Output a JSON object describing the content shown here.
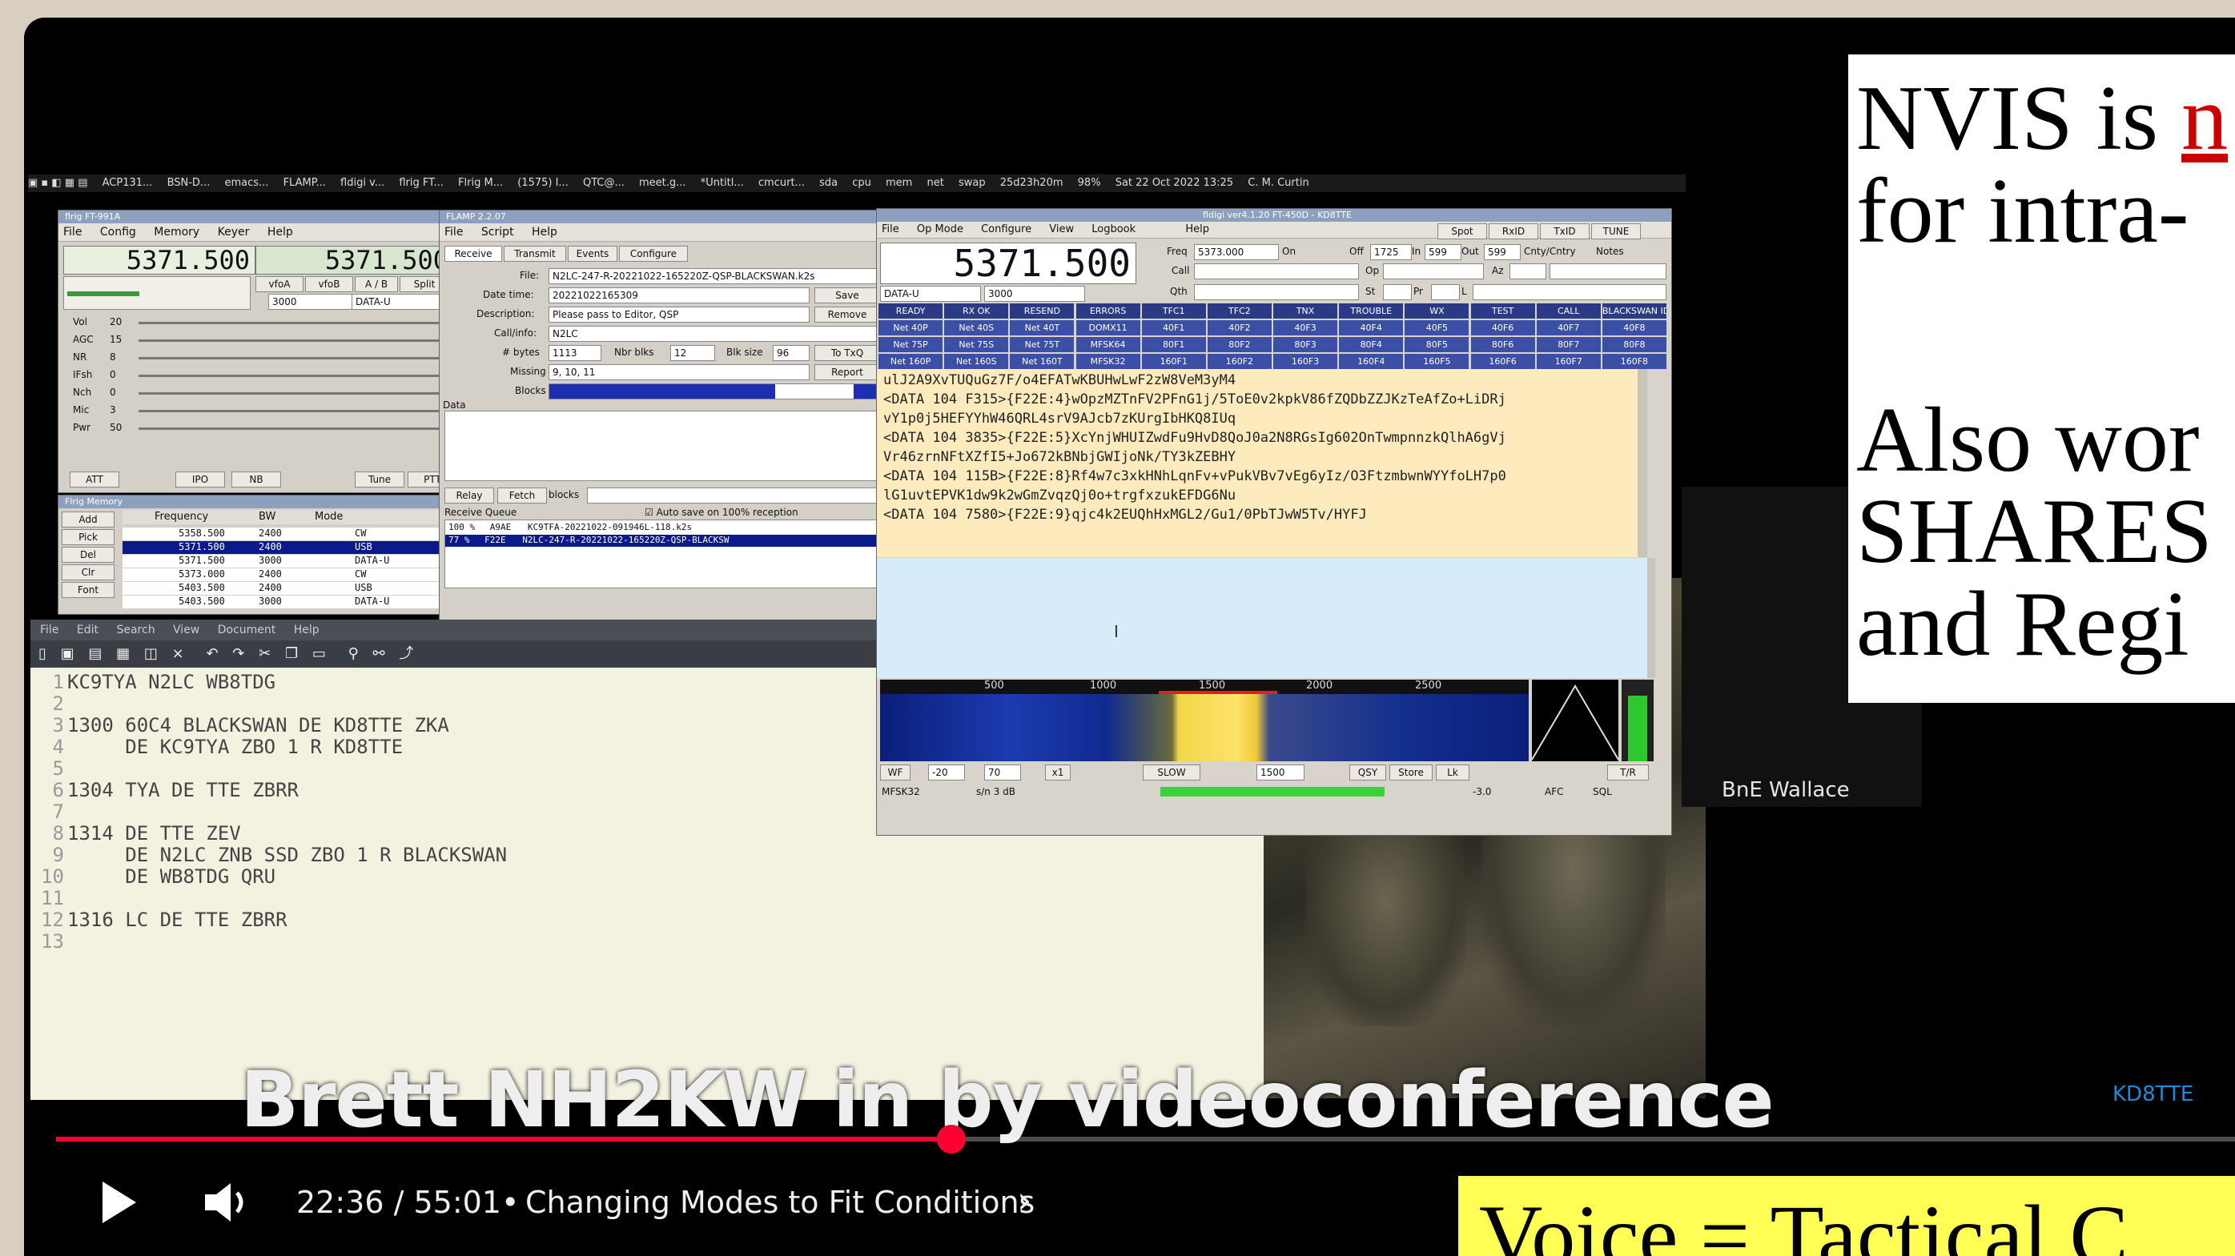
{
  "taskbar": {
    "items": [
      "ACP131...",
      "BSN-D...",
      "emacs...",
      "FLAMP...",
      "fldigi v...",
      "flrig FT...",
      "Flrig M...",
      "(1575) I...",
      "QTC@...",
      "meet.g...",
      "*Untitl...",
      "cmcurt...",
      "sda",
      "cpu",
      "mem",
      "net",
      "swap",
      "25d23h20m",
      "98%",
      "Sat 22 Oct 2022 13:25",
      "C. M. Curtin"
    ]
  },
  "flrig": {
    "title": "flrig FT-991A",
    "menu": [
      "File",
      "Config",
      "Memory",
      "Keyer",
      "Help"
    ],
    "freq_a": "5371.500",
    "freq_b": "5371.500",
    "buttons": [
      "vfoA",
      "vfoB",
      "A / B",
      "Split"
    ],
    "bw": "3000",
    "mode": "DATA-U",
    "sliders": [
      {
        "label": "Vol",
        "value": "20"
      },
      {
        "label": "AGC",
        "value": "15"
      },
      {
        "label": "NR",
        "value": "8"
      },
      {
        "label": "IFsh",
        "value": "0"
      },
      {
        "label": "Nch",
        "value": "0"
      },
      {
        "label": "Mic",
        "value": "3"
      },
      {
        "label": "Pwr",
        "value": "50"
      }
    ],
    "bottom_buttons": [
      "ATT",
      "IPO",
      "NB",
      "Tune",
      "PTT"
    ]
  },
  "memory": {
    "title": "Flrig Memory",
    "headers": [
      "Frequency",
      "BW",
      "Mode"
    ],
    "side_buttons": [
      "Add",
      "Pick",
      "Del",
      "Clr",
      "Font"
    ],
    "rows": [
      {
        "freq": "5358.500",
        "bw": "2400",
        "mode": "CW",
        "x": "60"
      },
      {
        "freq": "5371.500",
        "bw": "2400",
        "mode": "USB",
        "x": "60"
      },
      {
        "freq": "5371.500",
        "bw": "3000",
        "mode": "DATA-U",
        "x": "60"
      },
      {
        "freq": "5373.000",
        "bw": "2400",
        "mode": "CW",
        "x": "60"
      },
      {
        "freq": "5403.500",
        "bw": "2400",
        "mode": "USB",
        "x": "60"
      },
      {
        "freq": "5403.500",
        "bw": "3000",
        "mode": "DATA-U",
        "x": "60"
      }
    ]
  },
  "flamp": {
    "title": "FLAMP 2.2.07",
    "menu": [
      "File",
      "Script",
      "Help"
    ],
    "tabs": [
      "Receive",
      "Transmit",
      "Events",
      "Configure"
    ],
    "file_label": "File:",
    "file": "N2LC-247-R-20221022-165220Z-QSP-BLACKSWAN.k2s",
    "datetime_label": "Date time:",
    "datetime": "20221022165309",
    "save": "Save",
    "desc_label": "Description:",
    "desc": "Please pass to Editor, QSP",
    "remove": "Remove",
    "callinfo_label": "Call/info:",
    "callinfo": "N2LC",
    "bytes_label": "# bytes",
    "bytes": "1113",
    "nblks_label": "Nbr blks",
    "nblks": "12",
    "blksize_label": "Blk size",
    "blksize": "96",
    "totxq": "To TxQ",
    "missing_label": "Missing",
    "missing": "9, 10, 11",
    "report": "Report",
    "blocks_label": "Blocks",
    "data_label": "Data",
    "relay": "Relay",
    "fetch": "Fetch",
    "blocks2": "blocks",
    "queue_label": "Receive Queue",
    "autosave": "Auto save on 100% reception",
    "queue": [
      {
        "pct": "100 %",
        "id": "A9AE",
        "file": "KC9TFA-20221022-091946L-118.k2s"
      },
      {
        "pct": "77 %",
        "id": "F22E",
        "file": "N2LC-247-R-20221022-165220Z-QSP-BLACKSW"
      }
    ]
  },
  "editor": {
    "menu": [
      "File",
      "Edit",
      "Search",
      "View",
      "Document",
      "Help"
    ],
    "lines": [
      {
        "n": "1",
        "text": "KC9TYA N2LC WB8TDG"
      },
      {
        "n": "2",
        "text": ""
      },
      {
        "n": "3",
        "text": "1300 60C4 BLACKSWAN DE KD8TTE ZKA"
      },
      {
        "n": "4",
        "text": "     DE KC9TYA ZBO 1 R KD8TTE"
      },
      {
        "n": "5",
        "text": ""
      },
      {
        "n": "6",
        "text": "1304 TYA DE TTE ZBRR"
      },
      {
        "n": "7",
        "text": ""
      },
      {
        "n": "8",
        "text": "1314 DE TTE ZEV"
      },
      {
        "n": "9",
        "text": "     DE N2LC ZNB SSD ZBO 1 R BLACKSWAN"
      },
      {
        "n": "10",
        "text": "     DE WB8TDG QRU"
      },
      {
        "n": "11",
        "text": ""
      },
      {
        "n": "12",
        "text": "1316 LC DE TTE ZBRR"
      },
      {
        "n": "13",
        "text": ""
      }
    ]
  },
  "fldigi": {
    "title": "fldigi ver4.1.20 FT-450D - KD8TTE",
    "menu": [
      "File",
      "Op Mode",
      "Configure",
      "View",
      "Logbook",
      "Help"
    ],
    "top_buttons": [
      "Spot",
      "RxID",
      "TxID",
      "TUNE"
    ],
    "freq": "5371.500",
    "freq_label": "Freq",
    "freq_field": "5373.000",
    "on_label": "On",
    "off_label": "Off",
    "off": "1725",
    "in_label": "In",
    "in": "599",
    "out_label": "Out",
    "out": "599",
    "cnty_label": "Cnty/Cntry",
    "notes_label": "Notes",
    "call_label": "Call",
    "op_label": "Op",
    "az_label": "Az",
    "qth_label": "Qth",
    "st_label": "St",
    "pr_label": "Pr",
    "l_label": "L",
    "mode": "DATA-U",
    "bw": "3000",
    "macro_rows": [
      [
        "READY",
        "RX OK",
        "RESEND",
        "ERRORS",
        "TFC1",
        "TFC2",
        "TNX",
        "TROUBLE",
        "WX",
        "TEST",
        "CALL",
        "BLACKSWAN ID"
      ],
      [
        "Net 40P",
        "Net 40S",
        "Net 40T",
        "DOMX11",
        "40F1",
        "40F2",
        "40F3",
        "40F4",
        "40F5",
        "40F6",
        "40F7",
        "40F8"
      ],
      [
        "Net 75P",
        "Net 75S",
        "Net 75T",
        "MFSK64",
        "80F1",
        "80F2",
        "80F3",
        "80F4",
        "80F5",
        "80F6",
        "80F7",
        "80F8"
      ],
      [
        "Net 160P",
        "Net 160S",
        "Net 160T",
        "MFSK32",
        "160F1",
        "160F2",
        "160F3",
        "160F4",
        "160F5",
        "160F6",
        "160F7",
        "160F8"
      ]
    ],
    "rx_lines": [
      "ulJ2A9XvTUQuGz7F/o4EFATwKBUHwLwF2zW8VeM3yM4",
      "<DATA 104 F315>{F22E:4}wOpzMZTnFV2PFnG1j/5ToE0v2kpkV86fZQDbZZJKzTeAfZo+LiDRj",
      "vY1p0j5HEFYYhW46QRL4srV9AJcb7zKUrgIbHKQ8IUq",
      "<DATA 104 3835>{F22E:5}XcYnjWHUIZwdFu9HvD8QoJ0a2N8RGsIg602OnTwmpnnzkQlhA6gVj",
      "Vr46zrnNFtXZfI5+Jo672kBNbjGWIjoNk/TY3kZEBHY",
      "<DATA 104 115B>{F22E:8}Rf4w7c3xkHNhLqnFv+vPukVBv7vEg6yIz/O3FtzmbwnWYYfoLH7p0",
      "lG1uvtEPVK1dw9k2wGmZvqzQj0o+trgfxzukEFDG6Nu",
      "<DATA 104 7580>{F22E:9}qjc4k2EUQhHxMGL2/Gu1/0PbTJwW5Tv/HYFJ"
    ],
    "scale": [
      "500",
      "1000",
      "1500",
      "2000",
      "2500"
    ],
    "wf_controls": [
      "WF",
      "-20",
      "70",
      "x1",
      "SLOW",
      "1500",
      "QSY",
      "Store",
      "Lk",
      "T/R"
    ],
    "status_mode": "MFSK32",
    "status_sn": "s/n  3 dB",
    "status_right": [
      "-3.0",
      "AFC",
      "SQL"
    ]
  },
  "participant": {
    "name": "BnE Wallace",
    "label2": "KD8TTE"
  },
  "slide": {
    "line1_a": "NVIS is ",
    "line1_b": "n",
    "line2": "for intra-",
    "line3": "Also wor",
    "line4": "SHARES",
    "line5": "and Regi",
    "bottom": "Voice = Tactical C"
  },
  "player": {
    "caption": "Brett NH2KW in by videoconference",
    "time": "22:36 / 55:01",
    "separator": "•",
    "chapter": "Changing Modes to Fit Conditions",
    "progress": 0.411,
    "colors": {
      "progress": "#ff0033",
      "accent": "#ff0033"
    }
  },
  "colors": {
    "macro_blue": "#3b4fa4",
    "macro_dark": "#2a3a84",
    "rx_bg": "#fdebbe",
    "tx_bg": "#d6ecfa",
    "editor_bg": "#f3f1e0",
    "slide_yellow": "#ffff55",
    "link_red": "#cc0000"
  }
}
